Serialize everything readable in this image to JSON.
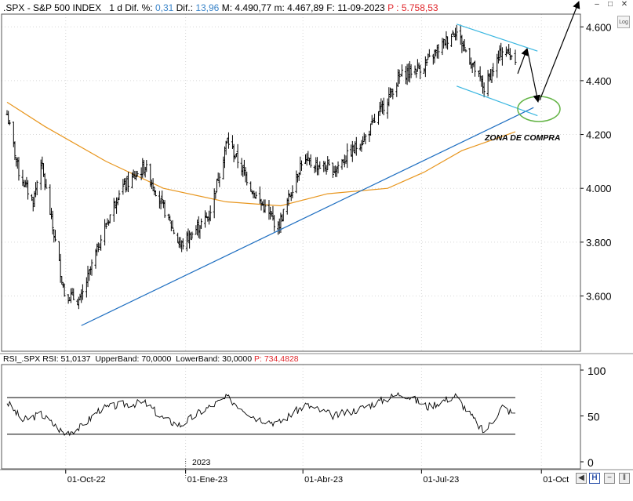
{
  "header": {
    "symbol": ".SPX",
    "sep": " - ",
    "name": "S&P 500 INDEX",
    "period": "1 d",
    "dif_pct_label": "Dif. %:",
    "dif_pct_value": "0,31",
    "dif_label": "Dif.:",
    "dif_value": "13,96",
    "max_label": "M:",
    "max_value": "4.490,77",
    "min_label": "m:",
    "min_value": "4.467,89",
    "date_label": "F:",
    "date_value": "11-09-2023",
    "p_label": "P :",
    "p_value": "5.758,53"
  },
  "rsi_header": {
    "name": "RSI_.SPX",
    "rsi_label": "RSI:",
    "rsi_value": "51,0137",
    "upper_label": "UpperBand:",
    "upper_value": "70,0000",
    "lower_label": "LowerBand:",
    "lower_value": "30,0000",
    "p_label": "P:",
    "p_value": "734,4828"
  },
  "buttons": {
    "log": "Log",
    "win_min": "–",
    "win_restore": "□",
    "win_close": "✕",
    "bottom_btn_1": "◀",
    "bottom_btn_2": "H",
    "bottom_btn_3": "−",
    "bottom_btn_4": "‖"
  },
  "annotation": "ZONA DE COMPRA",
  "year_label": "2023",
  "colors": {
    "candles": "#000000",
    "ma": "#e8961e",
    "trendline": "#1f6fc1",
    "channel": "#38b6e0",
    "ellipse": "#64b446",
    "arrows": "#000000",
    "grid": "#d8d8d8",
    "rsi_line": "#000000",
    "blue_text": "#3a84c9",
    "red_text": "#e0262b"
  },
  "chart_data": [
    {
      "type": "bar",
      "style": "ohlc",
      "y_axis_side": "right",
      "y_ticks": [
        3600,
        3800,
        4000,
        4200,
        4400,
        4600
      ],
      "y_tick_labels": [
        "3.600",
        "3.800",
        "4.000",
        "4.200",
        "4.400",
        "4.600"
      ],
      "ylim": [
        3430,
        4690
      ],
      "x_ticks": [
        "01-Oct-22",
        "01-Ene-23",
        "01-Abr-23",
        "01-Jul-23",
        "01-Oct"
      ],
      "approx_close_path": [
        {
          "date": "2022-08-17",
          "close": 4275
        },
        {
          "date": "2022-08-26",
          "close": 4060
        },
        {
          "date": "2022-09-06",
          "close": 3950
        },
        {
          "date": "2022-09-12",
          "close": 4100
        },
        {
          "date": "2022-09-30",
          "close": 3610
        },
        {
          "date": "2022-10-12",
          "close": 3580
        },
        {
          "date": "2022-10-27",
          "close": 3800
        },
        {
          "date": "2022-11-11",
          "close": 3990
        },
        {
          "date": "2022-12-01",
          "close": 4080
        },
        {
          "date": "2022-12-28",
          "close": 3785
        },
        {
          "date": "2023-01-19",
          "close": 3900
        },
        {
          "date": "2023-02-02",
          "close": 4180
        },
        {
          "date": "2023-02-24",
          "close": 3970
        },
        {
          "date": "2023-03-13",
          "close": 3855
        },
        {
          "date": "2023-03-31",
          "close": 4100
        },
        {
          "date": "2023-04-25",
          "close": 4070
        },
        {
          "date": "2023-05-19",
          "close": 4190
        },
        {
          "date": "2023-06-15",
          "close": 4420
        },
        {
          "date": "2023-07-03",
          "close": 4455
        },
        {
          "date": "2023-07-27",
          "close": 4590
        },
        {
          "date": "2023-08-18",
          "close": 4370
        },
        {
          "date": "2023-09-01",
          "close": 4515
        },
        {
          "date": "2023-09-11",
          "close": 4487
        }
      ],
      "moving_average": [
        {
          "date": "2022-08-17",
          "value": 4320
        },
        {
          "date": "2022-09-15",
          "value": 4230
        },
        {
          "date": "2022-11-01",
          "value": 4100
        },
        {
          "date": "2022-12-15",
          "value": 4000
        },
        {
          "date": "2023-02-01",
          "value": 3950
        },
        {
          "date": "2023-03-15",
          "value": 3935
        },
        {
          "date": "2023-04-20",
          "value": 3980
        },
        {
          "date": "2023-06-05",
          "value": 4000
        },
        {
          "date": "2023-07-03",
          "value": 4060
        },
        {
          "date": "2023-08-01",
          "value": 4140
        },
        {
          "date": "2023-09-11",
          "value": 4210
        }
      ],
      "trendline": [
        {
          "date": "2022-10-13",
          "value": 3490
        },
        {
          "date": "2023-09-25",
          "value": 4300
        }
      ],
      "channel_upper": [
        {
          "date": "2023-07-28",
          "value": 4610
        },
        {
          "date": "2023-09-28",
          "value": 4510
        }
      ],
      "channel_lower": [
        {
          "date": "2023-07-28",
          "value": 4380
        },
        {
          "date": "2023-09-28",
          "value": 4270
        }
      ]
    },
    {
      "type": "line",
      "title": "RSI_.SPX",
      "y_ticks": [
        0,
        50,
        100
      ],
      "ylim": [
        -5,
        105
      ],
      "bands": {
        "upper": 70,
        "lower": 30
      },
      "series": [
        {
          "name": "RSI",
          "points": [
            {
              "date": "2022-08-17",
              "value": 65
            },
            {
              "date": "2022-08-29",
              "value": 45
            },
            {
              "date": "2022-09-12",
              "value": 52
            },
            {
              "date": "2022-09-30",
              "value": 31
            },
            {
              "date": "2022-10-13",
              "value": 38
            },
            {
              "date": "2022-10-27",
              "value": 57
            },
            {
              "date": "2022-11-15",
              "value": 63
            },
            {
              "date": "2022-12-01",
              "value": 64
            },
            {
              "date": "2022-12-16",
              "value": 46
            },
            {
              "date": "2022-12-28",
              "value": 40
            },
            {
              "date": "2023-01-13",
              "value": 55
            },
            {
              "date": "2023-02-02",
              "value": 70
            },
            {
              "date": "2023-02-24",
              "value": 48
            },
            {
              "date": "2023-03-13",
              "value": 42
            },
            {
              "date": "2023-04-03",
              "value": 62
            },
            {
              "date": "2023-04-25",
              "value": 50
            },
            {
              "date": "2023-05-15",
              "value": 58
            },
            {
              "date": "2023-06-16",
              "value": 75
            },
            {
              "date": "2023-07-06",
              "value": 60
            },
            {
              "date": "2023-07-27",
              "value": 72
            },
            {
              "date": "2023-08-18",
              "value": 32
            },
            {
              "date": "2023-09-01",
              "value": 60
            },
            {
              "date": "2023-09-11",
              "value": 51
            }
          ]
        }
      ]
    }
  ]
}
